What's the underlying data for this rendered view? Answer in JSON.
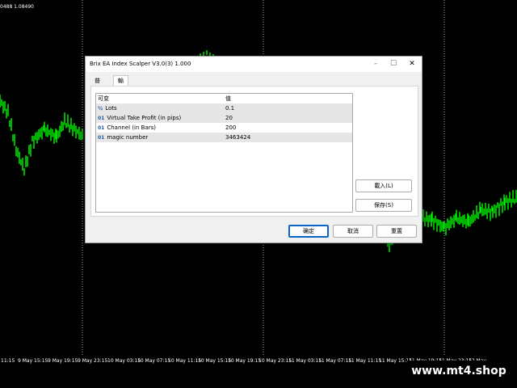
{
  "chart": {
    "price_label": "0488 1.08490",
    "time_labels": [
      "11:15",
      "9 May 15:15",
      "9 May 19:15",
      "9 May 23:15",
      "10 May 03:15",
      "10 May 07:15",
      "10 May 11:15",
      "10 May 15:15",
      "10 May 19:15",
      "10 May 23:15",
      "11 May 03:15",
      "11 May 07:15",
      "11 May 11:15",
      "11 May 15:15",
      "11 May 19:15",
      "11 May 23:15",
      "12 May"
    ],
    "candle_color": "#00ff00",
    "background": "#000000"
  },
  "watermark": "www.mt4.shop",
  "dialog": {
    "title": "Brix EA Index Scalper V3.0(3) 1.000",
    "controls": [
      "–",
      "☐",
      "✕"
    ],
    "tabs": [
      "普通",
      "輸入"
    ],
    "active_tab": 1,
    "columns": [
      "可变",
      "值"
    ],
    "rows": [
      {
        "icon": "½",
        "name": "Lots",
        "value": "0.1"
      },
      {
        "icon": "01",
        "name": "Virtual Take Profit (in pips)",
        "value": "20"
      },
      {
        "icon": "01",
        "name": "Channel (in Bars)",
        "value": "200"
      },
      {
        "icon": "01",
        "name": "magic number",
        "value": "3463424"
      }
    ],
    "load_button": "載入(L)",
    "save_button": "保存(S)",
    "ok_button": "确定",
    "cancel_button": "取消",
    "reset_button": "重置"
  }
}
